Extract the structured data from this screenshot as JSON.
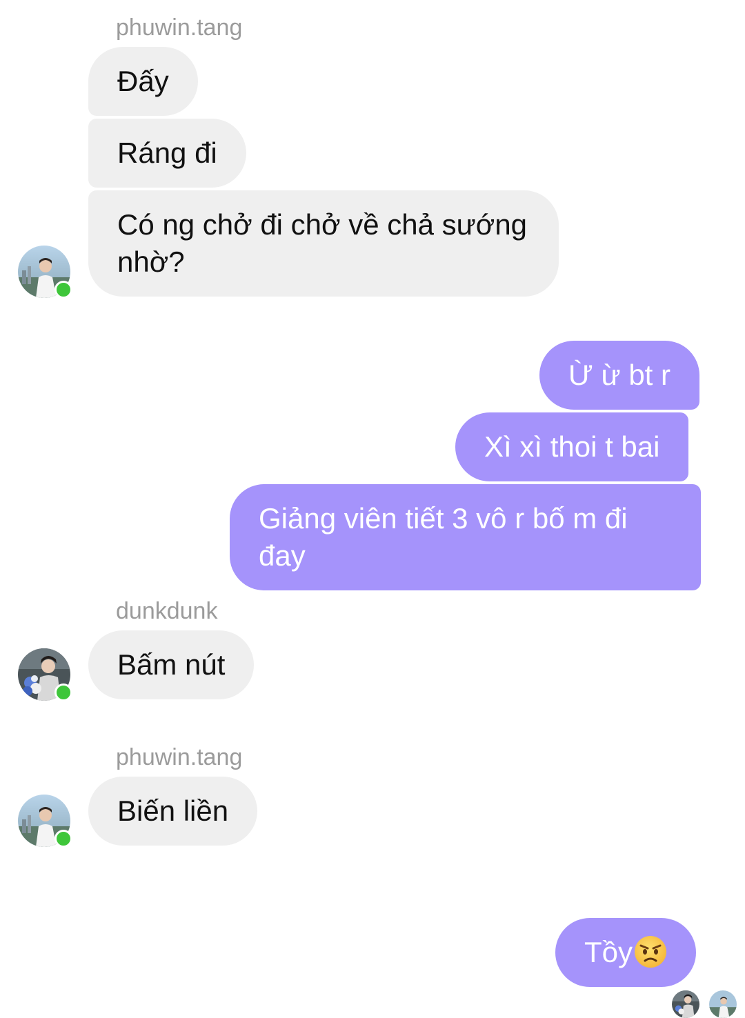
{
  "groups": [
    {
      "sender": "phuwin.tang",
      "messages": [
        "Đấy",
        "Ráng đi",
        "Có ng chở đi chở về chả sướng nhờ?"
      ]
    },
    {
      "sender": "",
      "outgoing": true,
      "messages": [
        "Ừ ừ bt r",
        "Xì xì thoi t bai",
        "Giảng viên tiết 3 vô r bố m đi đay"
      ]
    },
    {
      "sender": "dunkdunk",
      "messages": [
        "Bấm nút"
      ]
    },
    {
      "sender": "phuwin.tang",
      "messages": [
        "Biến liền"
      ]
    },
    {
      "sender": "",
      "outgoing": true,
      "messages": [
        "Tồy"
      ]
    }
  ],
  "last_message_emoji": "angry-face-emoji",
  "icons": {
    "avatar_phuwin": "avatar-phuwin",
    "avatar_dunk": "avatar-dunkdunk",
    "online_indicator": "online-dot"
  },
  "colors": {
    "incoming_bubble": "#efefef",
    "outgoing_bubble": "#a593fb",
    "sender_label": "#9b9b9b",
    "online": "#3ec63a"
  }
}
